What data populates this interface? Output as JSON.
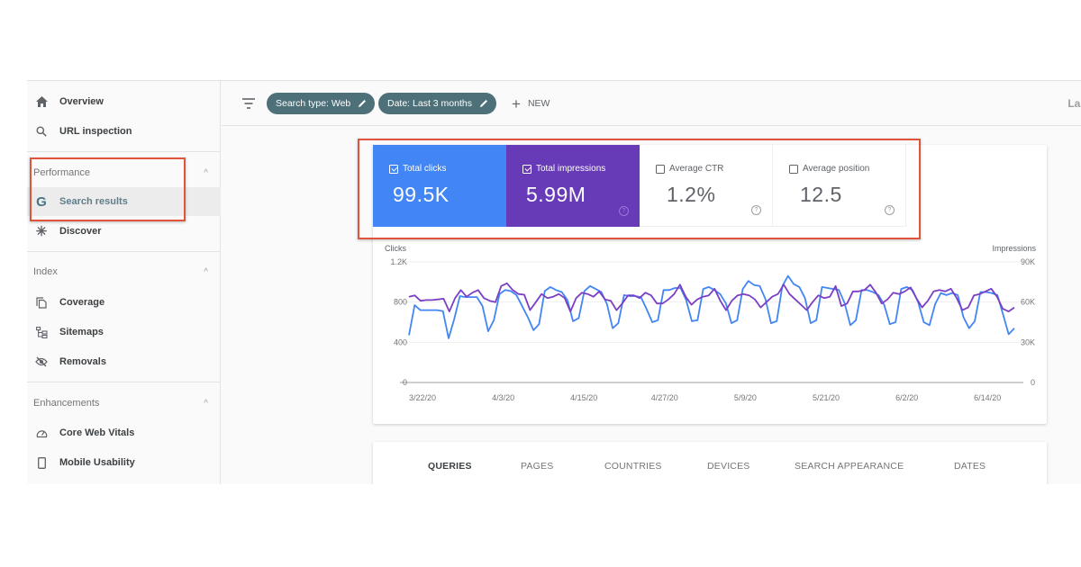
{
  "sidebar": {
    "top_items": [
      {
        "label": "Overview",
        "icon": "home-icon"
      },
      {
        "label": "URL inspection",
        "icon": "search-icon"
      }
    ],
    "sections": [
      {
        "title": "Performance",
        "expanded": true,
        "items": [
          {
            "label": "Search results",
            "icon": "google-g-icon",
            "active": true
          },
          {
            "label": "Discover",
            "icon": "discover-asterisk-icon",
            "active": false
          }
        ]
      },
      {
        "title": "Index",
        "expanded": true,
        "items": [
          {
            "label": "Coverage",
            "icon": "coverage-icon"
          },
          {
            "label": "Sitemaps",
            "icon": "sitemap-icon"
          },
          {
            "label": "Removals",
            "icon": "eye-off-icon"
          }
        ]
      },
      {
        "title": "Enhancements",
        "expanded": true,
        "items": [
          {
            "label": "Core Web Vitals",
            "icon": "gauge-icon"
          },
          {
            "label": "Mobile Usability",
            "icon": "phone-icon"
          }
        ]
      }
    ]
  },
  "toolbar": {
    "filters": [
      {
        "label": "Search type: Web"
      },
      {
        "label": "Date: Last 3 months"
      }
    ],
    "new_label": "NEW",
    "last_updated_truncated": "Las"
  },
  "metrics": [
    {
      "label": "Total clicks",
      "value": "99.5K",
      "checked": true,
      "color": "#4285f4"
    },
    {
      "label": "Total impressions",
      "value": "5.99M",
      "checked": true,
      "color": "#673ab7"
    },
    {
      "label": "Average CTR",
      "value": "1.2%",
      "checked": false
    },
    {
      "label": "Average position",
      "value": "12.5",
      "checked": false
    }
  ],
  "chart_data": {
    "type": "line",
    "left_axis_title": "Clicks",
    "right_axis_title": "Impressions",
    "left_ticks": [
      "0",
      "400",
      "800",
      "1.2K"
    ],
    "right_ticks": [
      "0",
      "30K",
      "60K",
      "90K"
    ],
    "left_ylim": [
      0,
      1200
    ],
    "right_ylim": [
      0,
      90000
    ],
    "x_tick_labels": [
      "3/22/20",
      "4/3/20",
      "4/15/20",
      "4/27/20",
      "5/9/20",
      "5/21/20",
      "6/2/20",
      "6/14/20"
    ],
    "x_start": "3/22/20",
    "days": 91,
    "grid": true,
    "series": [
      {
        "name": "Clicks",
        "axis": "left",
        "color": "#4285f4",
        "values": [
          470,
          770,
          720,
          720,
          720,
          720,
          710,
          440,
          630,
          860,
          850,
          850,
          850,
          760,
          510,
          620,
          880,
          920,
          910,
          870,
          760,
          650,
          520,
          580,
          910,
          950,
          920,
          900,
          820,
          610,
          640,
          910,
          960,
          930,
          900,
          780,
          540,
          590,
          870,
          860,
          860,
          850,
          730,
          600,
          620,
          920,
          920,
          940,
          940,
          820,
          610,
          620,
          930,
          950,
          920,
          880,
          790,
          590,
          620,
          930,
          1010,
          970,
          960,
          830,
          590,
          610,
          960,
          1060,
          980,
          950,
          840,
          590,
          620,
          950,
          940,
          930,
          920,
          790,
          570,
          620,
          920,
          920,
          900,
          870,
          770,
          580,
          600,
          930,
          950,
          920,
          800,
          600,
          570,
          780,
          890,
          870,
          890,
          870,
          650,
          540,
          610,
          900,
          900,
          890,
          870,
          680,
          480,
          540
        ]
      },
      {
        "name": "Impressions",
        "axis": "left-scaled",
        "color": "#7b3fc4",
        "values": [
          64000,
          65000,
          61000,
          61500,
          61500,
          62000,
          62500,
          53000,
          63000,
          69000,
          64000,
          67000,
          69000,
          63000,
          61000,
          60000,
          72000,
          74000,
          69000,
          66000,
          65500,
          54000,
          60000,
          66000,
          63000,
          64000,
          66000,
          63000,
          53000,
          63000,
          67000,
          66000,
          64000,
          68000,
          62000,
          61000,
          54000,
          59000,
          65000,
          65000,
          63000,
          67000,
          65000,
          59000,
          59000,
          62000,
          66000,
          73000,
          64000,
          58000,
          62000,
          64000,
          65000,
          70000,
          61000,
          54000,
          61000,
          65000,
          66000,
          65000,
          62000,
          56000,
          60000,
          64000,
          66000,
          73000,
          66000,
          62000,
          58000,
          54000,
          60000,
          65000,
          63000,
          64000,
          72000,
          57000,
          59000,
          68000,
          68000,
          69000,
          73000,
          67000,
          59000,
          62000,
          67000,
          66000,
          68000,
          71000,
          63000,
          56000,
          61000,
          68000,
          69000,
          68000,
          70000,
          63000,
          54000,
          56000,
          65000,
          66000,
          68000,
          70000,
          64000,
          55000,
          53000,
          56000
        ]
      }
    ]
  },
  "tabs": [
    {
      "label": "QUERIES",
      "active": true
    },
    {
      "label": "PAGES",
      "active": false
    },
    {
      "label": "COUNTRIES",
      "active": false
    },
    {
      "label": "DEVICES",
      "active": false
    },
    {
      "label": "SEARCH APPEARANCE",
      "active": false
    },
    {
      "label": "DATES",
      "active": false
    }
  ]
}
